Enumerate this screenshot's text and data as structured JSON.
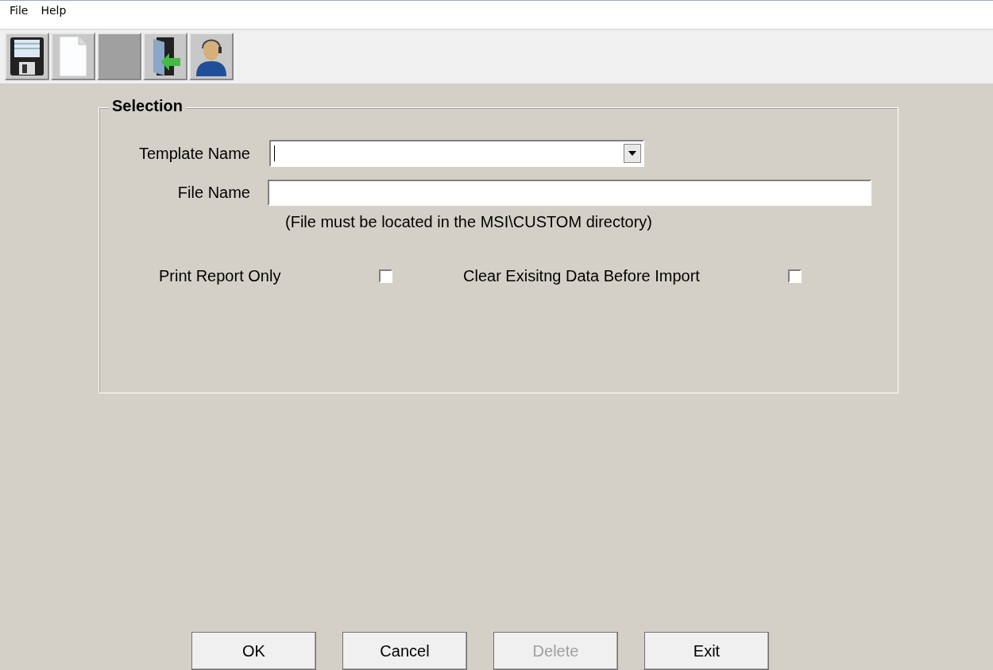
{
  "menu": [
    "File",
    "Help"
  ],
  "toolbar": [
    {
      "kind": "save",
      "disabled": false
    },
    {
      "kind": "new",
      "disabled": false
    },
    {
      "kind": "blank",
      "disabled": true
    },
    {
      "kind": "exit",
      "disabled": false
    },
    {
      "kind": "support",
      "disabled": false
    }
  ],
  "selection": {
    "title": "Selection",
    "template_name": {
      "label": "Template Name"
    },
    "file_name": {
      "label": "File Name"
    },
    "note": "(File must be located in the MSI\\CUSTOM directory)",
    "options": [
      {
        "label": "Print Report Only",
        "checked": false
      },
      {
        "label": "Clear Exisitng Data Before Import",
        "checked": false
      }
    ]
  },
  "buttons": [
    {
      "label": "OK",
      "disabled": false
    },
    {
      "label": "Cancel",
      "disabled": false
    },
    {
      "label": "Delete",
      "disabled": true
    },
    {
      "label": "Exit",
      "disabled": false
    }
  ]
}
